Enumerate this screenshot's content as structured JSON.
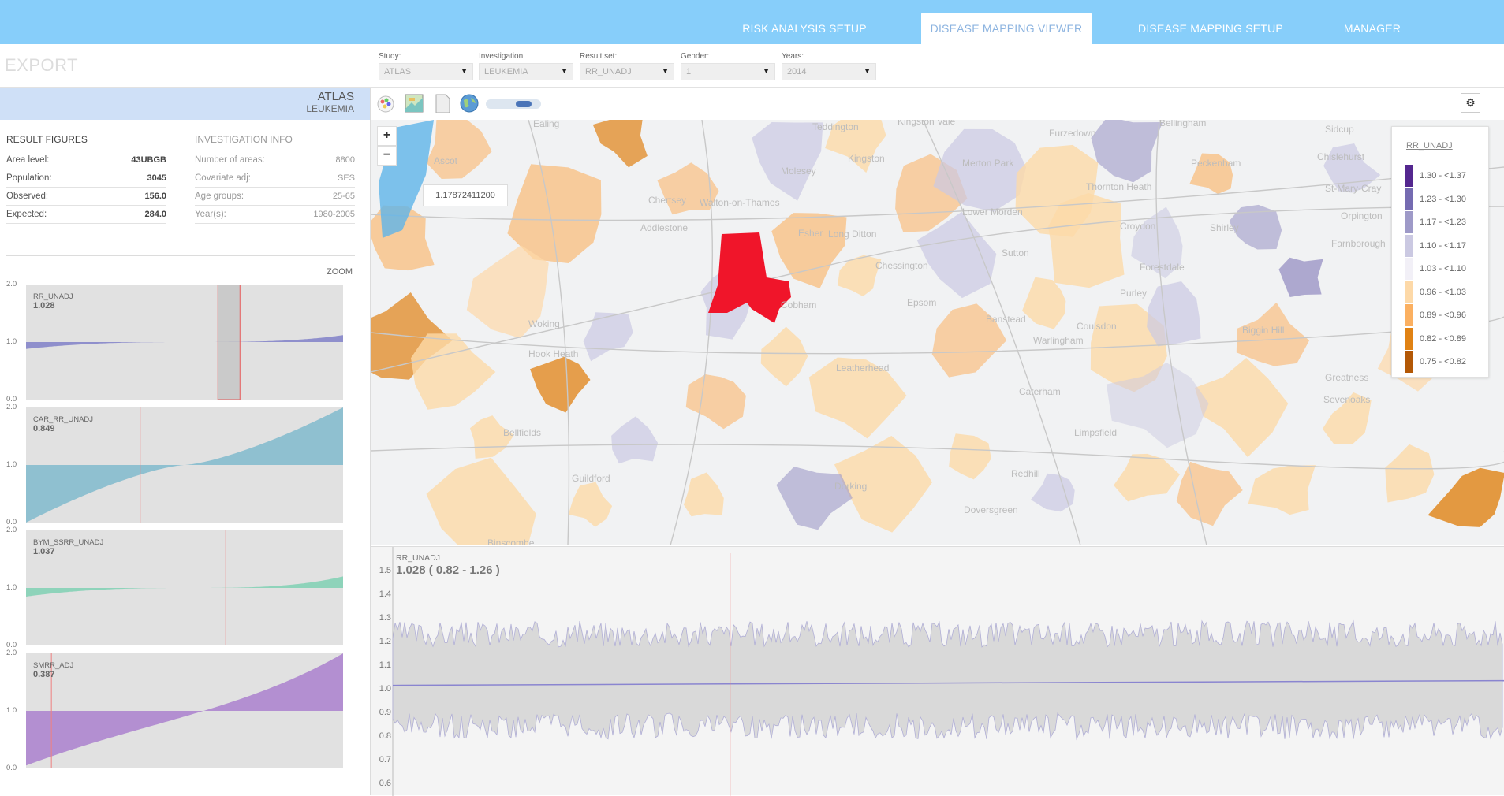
{
  "nav": {
    "tabs": [
      {
        "label": "RISK ANALYSIS SETUP",
        "active": false
      },
      {
        "label": "DISEASE MAPPING VIEWER",
        "active": true
      },
      {
        "label": "DISEASE MAPPING SETUP",
        "active": false
      },
      {
        "label": "MANAGER",
        "active": false
      }
    ]
  },
  "export_label": "EXPORT",
  "selectors": [
    {
      "label": "Study:",
      "value": "ATLAS"
    },
    {
      "label": "Investigation:",
      "value": "LEUKEMIA"
    },
    {
      "label": "Result set:",
      "value": "RR_UNADJ"
    },
    {
      "label": "Gender:",
      "value": "1"
    },
    {
      "label": "Years:",
      "value": "2014"
    }
  ],
  "study_header": {
    "study": "ATLAS",
    "investigation": "LEUKEMIA"
  },
  "result_figures": {
    "title": "RESULT FIGURES",
    "rows": [
      {
        "key": "Area level:",
        "value": "43UBGB"
      },
      {
        "key": "Population:",
        "value": "3045"
      },
      {
        "key": "Observed:",
        "value": "156.0"
      },
      {
        "key": "Expected:",
        "value": "284.0"
      }
    ]
  },
  "investigation_info": {
    "title": "INVESTIGATION INFO",
    "rows": [
      {
        "key": "Number of areas:",
        "value": "8800"
      },
      {
        "key": "Covariate adj:",
        "value": "SES"
      },
      {
        "key": "Age groups:",
        "value": "25-65"
      },
      {
        "key": "Year(s):",
        "value": "1980-2005"
      }
    ]
  },
  "zoom_label": "ZOOM",
  "mini_charts": [
    {
      "name": "RR_UNADJ",
      "value": "1.028",
      "color": "#8f8fcc",
      "ticks": [
        "2.0",
        "1.0",
        "0.0"
      ],
      "marker": 0.64,
      "highlight": true
    },
    {
      "name": "CAR_RR_UNADJ",
      "value": "0.849",
      "color": "#8fc0d0",
      "ticks": [
        "2.0",
        "1.0",
        "0.0"
      ],
      "marker": 0.36,
      "highlight": false
    },
    {
      "name": "BYM_SSRR_UNADJ",
      "value": "1.037",
      "color": "#8ed3ba",
      "ticks": [
        "2.0",
        "1.0",
        "0.0"
      ],
      "marker": 0.63,
      "highlight": false
    },
    {
      "name": "SMRR_ADJ",
      "value": "0.387",
      "color": "#b38fd1",
      "ticks": [
        "2.0",
        "1.0",
        "0.0"
      ],
      "marker": 0.08,
      "highlight": false
    }
  ],
  "map": {
    "tooltip": "1.17872411200",
    "zoom_in": "+",
    "zoom_out": "−",
    "places": [
      "Ealing",
      "Teddington",
      "Kingston Vale",
      "Furzedown",
      "Bellingham",
      "Sidcup",
      "Ascot",
      "Molesey",
      "Kingston",
      "Merton Park",
      "Peckenham",
      "Chislehurst",
      "Chertsey",
      "Walton-on-Thames",
      "Lower Morden",
      "Thornton Heath",
      "St-Mary-Cray",
      "Addlestone",
      "Long Ditton",
      "Esher",
      "Croydon",
      "Shirley",
      "Orpington",
      "Chessington",
      "Sutton",
      "Forestdale",
      "Farnborough",
      "Cobham",
      "Epsom",
      "Purley",
      "Woking",
      "Banstead",
      "Coulsdon",
      "Biggin Hill",
      "Hook Heath",
      "Leatherhead",
      "Warlingham",
      "Greatness",
      "Caterham",
      "Sevenoaks",
      "Bellfields",
      "Limpsfield",
      "Guildford",
      "Redhill",
      "Dorking",
      "Doversgreen",
      "Binscombe"
    ],
    "legend": {
      "title": "RR_UNADJ",
      "items": [
        {
          "label": "1.30 - <1.37",
          "color": "#54278f"
        },
        {
          "label": "1.23 - <1.30",
          "color": "#756bb1"
        },
        {
          "label": "1.17 - <1.23",
          "color": "#9e9ac8"
        },
        {
          "label": "1.10 - <1.17",
          "color": "#cbc9e2"
        },
        {
          "label": "1.03 - <1.10",
          "color": "#f2f0f7"
        },
        {
          "label": "0.96 - <1.03",
          "color": "#fdd9a8"
        },
        {
          "label": "0.89 - <0.96",
          "color": "#fbb061"
        },
        {
          "label": "0.82 - <0.89",
          "color": "#e08214"
        },
        {
          "label": "0.75 - <0.82",
          "color": "#b35806"
        }
      ]
    }
  },
  "bottom_chart": {
    "name": "RR_UNADJ",
    "value_label": "1.028 ( 0.82 - 1.26 )",
    "y_ticks": [
      "1.5",
      "1.4",
      "1.3",
      "1.2",
      "1.1",
      "1.0",
      "0.9",
      "0.8",
      "0.7",
      "0.6"
    ],
    "y_range": [
      0.55,
      1.55
    ],
    "line_value": 1.028,
    "band": [
      0.82,
      1.26
    ],
    "marker_position": 0.3
  }
}
